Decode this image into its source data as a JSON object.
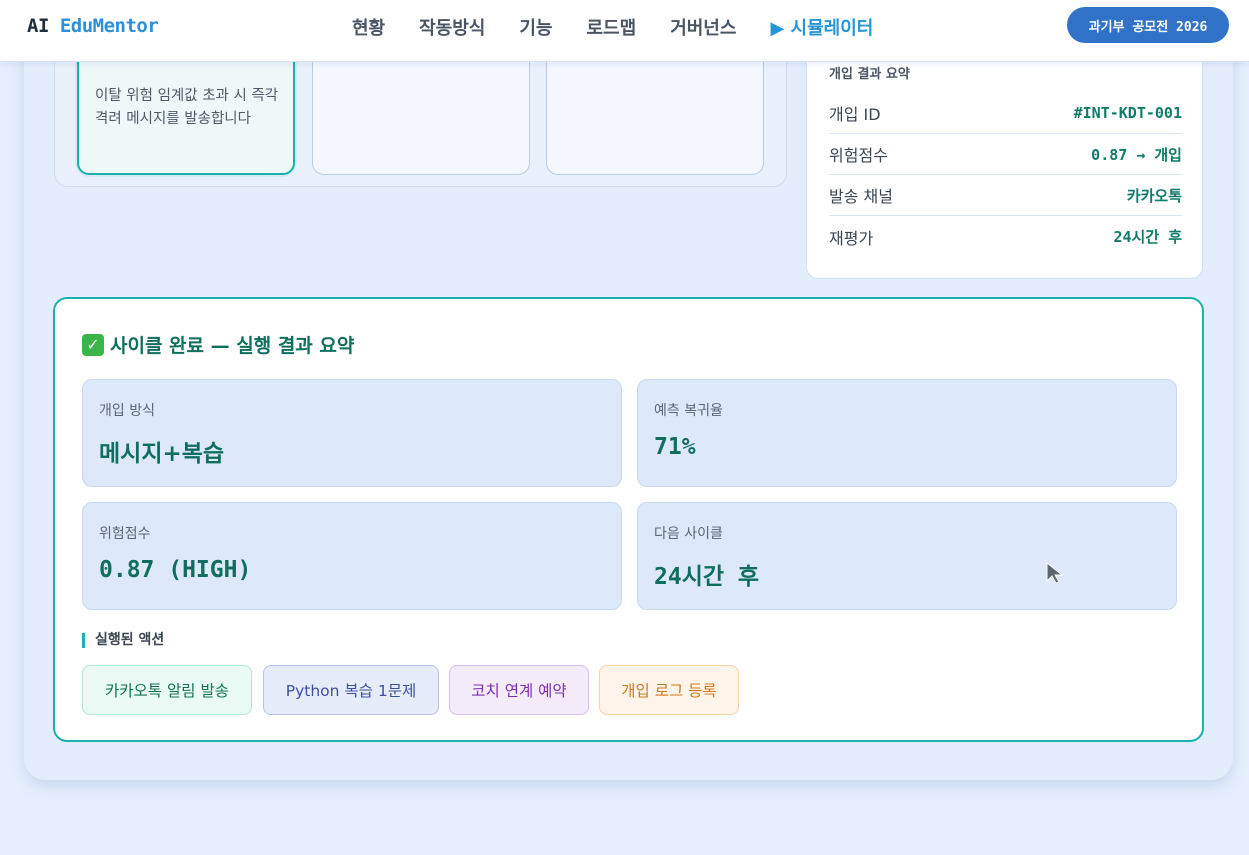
{
  "nav": {
    "logo_ai": "AI",
    "logo_brand": "EduMentor",
    "links": [
      "현황",
      "작동방식",
      "기능",
      "로드맵",
      "거버넌스",
      "▶ 시뮬레이터"
    ],
    "badge": "과기부 공모전 2026"
  },
  "steps": {
    "active_text": "이탈 위험 임계값 초과 시 즉각 격려 메시지를 발송합니다"
  },
  "summary": {
    "title": "개입 결과 요약",
    "rows": [
      {
        "key": "개입 ID",
        "value": "#INT-KDT-001"
      },
      {
        "key": "위험점수",
        "value": "0.87 → 개입"
      },
      {
        "key": "발송 채널",
        "value": "카카오톡"
      },
      {
        "key": "재평가",
        "value": "24시간 후"
      }
    ]
  },
  "result": {
    "title": "사이클 완료 — 실행 결과 요약",
    "metrics": [
      {
        "label": "개입 방식",
        "value": "메시지+복습"
      },
      {
        "label": "예측 복귀율",
        "value": "71%"
      },
      {
        "label": "위험점수",
        "value": "0.87 (HIGH)"
      },
      {
        "label": "다음 사이클",
        "value": "24시간 후"
      }
    ],
    "actions_label": "실행된 액션",
    "actions": [
      "카카오톡 알림 발송",
      "Python 복습 1문제",
      "코치 연계 예약",
      "개입 로그 등록"
    ]
  },
  "colors": {
    "accent_teal": "#1cb0ad",
    "value_green": "#0f7b68",
    "nav_blue": "#2f72c8"
  }
}
